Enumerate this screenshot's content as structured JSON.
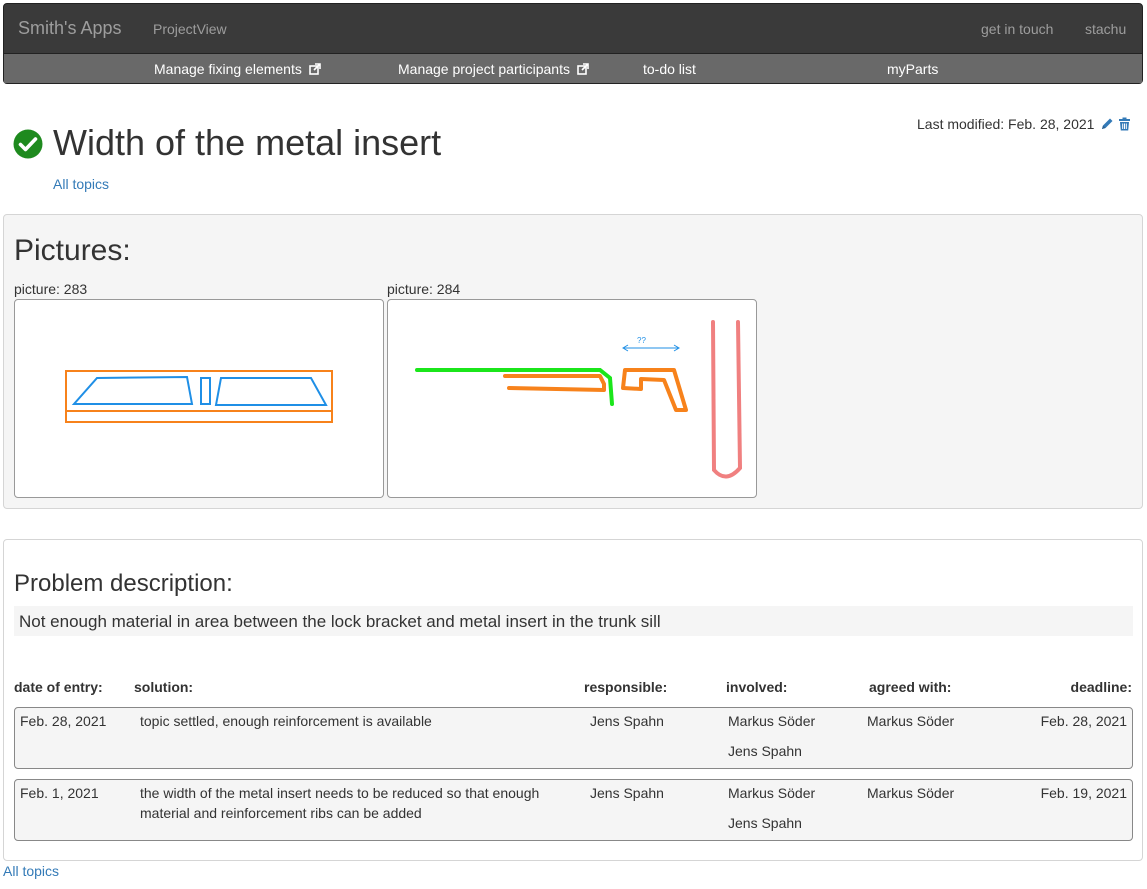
{
  "navbar": {
    "brand": "Smith's Apps",
    "app_name": "ProjectView",
    "contact": "get in touch",
    "user": "stachu",
    "subnav": [
      {
        "label": "Manage fixing elements",
        "icon": "external-link-icon"
      },
      {
        "label": "Manage project participants",
        "icon": "external-link-icon"
      },
      {
        "label": "to-do list"
      },
      {
        "label": "myParts"
      }
    ]
  },
  "header": {
    "status_icon": "check-circle-icon",
    "status_color": "#1e8a1e",
    "title": "Width of the metal insert",
    "last_modified": "Last modified: Feb. 28, 2021",
    "edit_icon": "pencil-icon",
    "delete_icon": "trash-icon",
    "all_topics": "All topics"
  },
  "pictures": {
    "heading": "Pictures:",
    "items": [
      {
        "label": "picture: 283"
      },
      {
        "label": "picture: 284",
        "annotation": "??"
      }
    ]
  },
  "problem": {
    "heading": "Problem description:",
    "text": "Not enough material in area between the lock bracket and metal insert in the trunk sill",
    "columns": {
      "date": "date of entry:",
      "solution": "solution:",
      "responsible": "responsible:",
      "involved": "involved:",
      "agreed": "agreed with:",
      "deadline": "deadline:"
    },
    "entries": [
      {
        "date": "Feb. 28, 2021",
        "solution": "topic settled, enough reinforcement is available",
        "responsible": "Jens Spahn",
        "involved": [
          "Markus Söder",
          "Jens Spahn"
        ],
        "agreed": "Markus Söder",
        "deadline": "Feb. 28, 2021"
      },
      {
        "date": "Feb. 1, 2021",
        "solution": "the width of the metal insert needs to be reduced so that enough material and reinforcement ribs can be added",
        "responsible": "Jens Spahn",
        "involved": [
          "Markus Söder",
          "Jens Spahn"
        ],
        "agreed": "Markus Söder",
        "deadline": "Feb. 19, 2021"
      }
    ]
  },
  "footer": {
    "all_topics": "All topics"
  },
  "colors": {
    "navbar": "#3a3a3a",
    "subnav": "#696969",
    "link": "#337ab7",
    "sketch_orange": "#f7821b",
    "sketch_blue": "#1f8fe6",
    "sketch_green": "#1be61b",
    "sketch_red": "#f08080"
  }
}
